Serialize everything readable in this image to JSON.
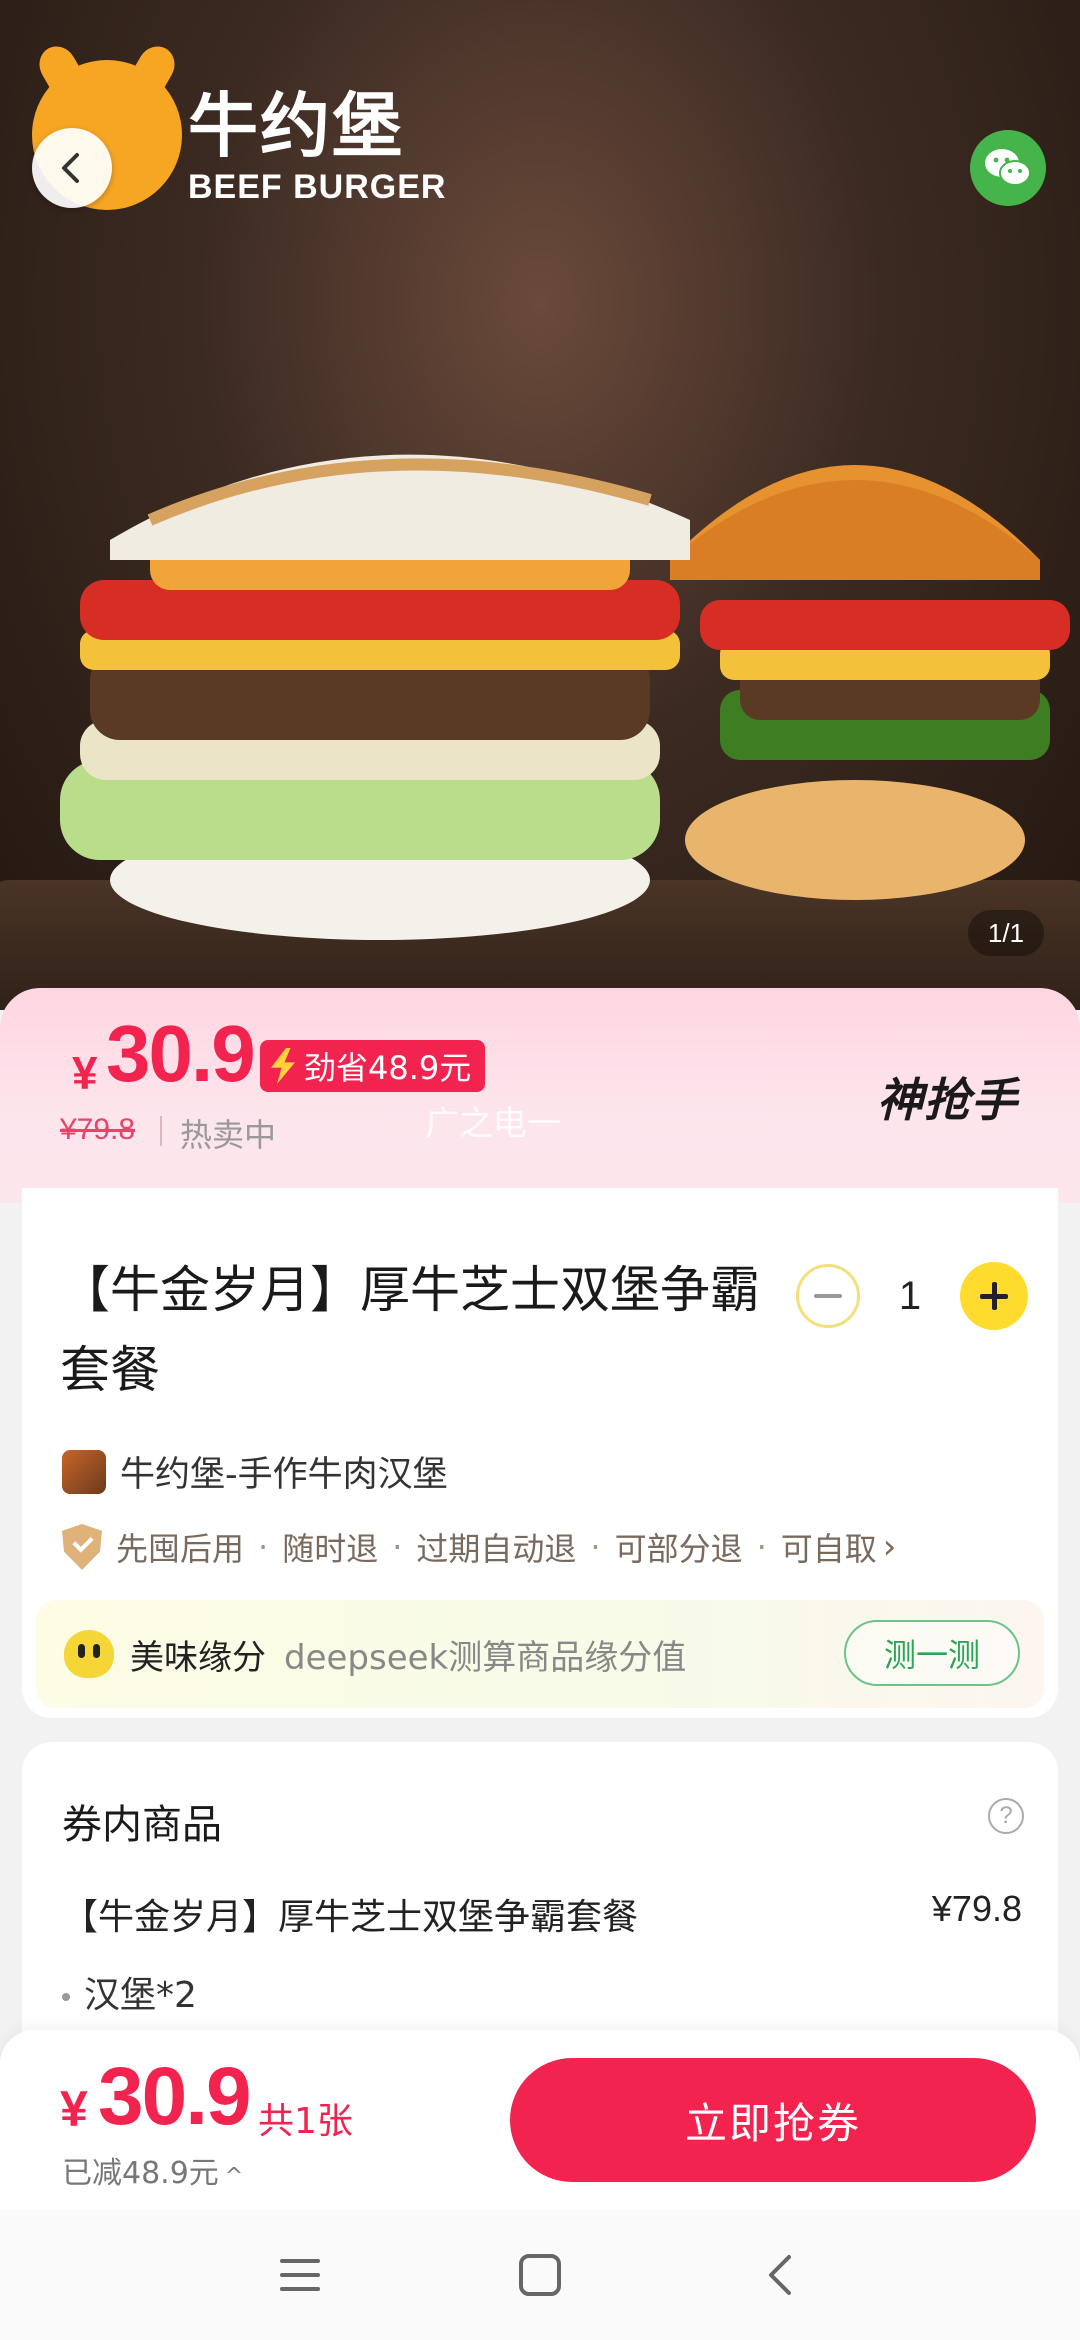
{
  "hero": {
    "brand_cn": "牛约堡",
    "brand_en": "BEEF BURGER",
    "page_indicator": "1/1"
  },
  "price_banner": {
    "currency": "¥",
    "price": "30.9",
    "save_label": "劲省48.9元",
    "original_price": "¥79.8",
    "status": "热卖中",
    "watermark": "广之电一",
    "partner_brand": "神抢手"
  },
  "product": {
    "title": "【牛金岁月】厚牛芝士双堡争霸套餐",
    "quantity": "1",
    "shop_name": "牛约堡-手作牛肉汉堡",
    "services": [
      "先囤后用",
      "随时退",
      "过期自动退",
      "可部分退",
      "可自取"
    ],
    "match": {
      "label": "美味缘分",
      "description": "deepseek测算商品缘分值",
      "button": "测一测"
    }
  },
  "contents": {
    "title": "券内商品",
    "help": "?",
    "item_name": "【牛金岁月】厚牛芝士双堡争霸套餐",
    "item_price": "¥79.8",
    "subitem": "汉堡*2"
  },
  "bottom_bar": {
    "currency": "¥",
    "price": "30.9",
    "count": "共1张",
    "reduced": "已减48.9元",
    "cta": "立即抢券"
  },
  "colors": {
    "accent": "#f2234f",
    "qty_plus": "#ffdb2e",
    "match_button": "#2aa657",
    "wechat": "#45b44a"
  }
}
